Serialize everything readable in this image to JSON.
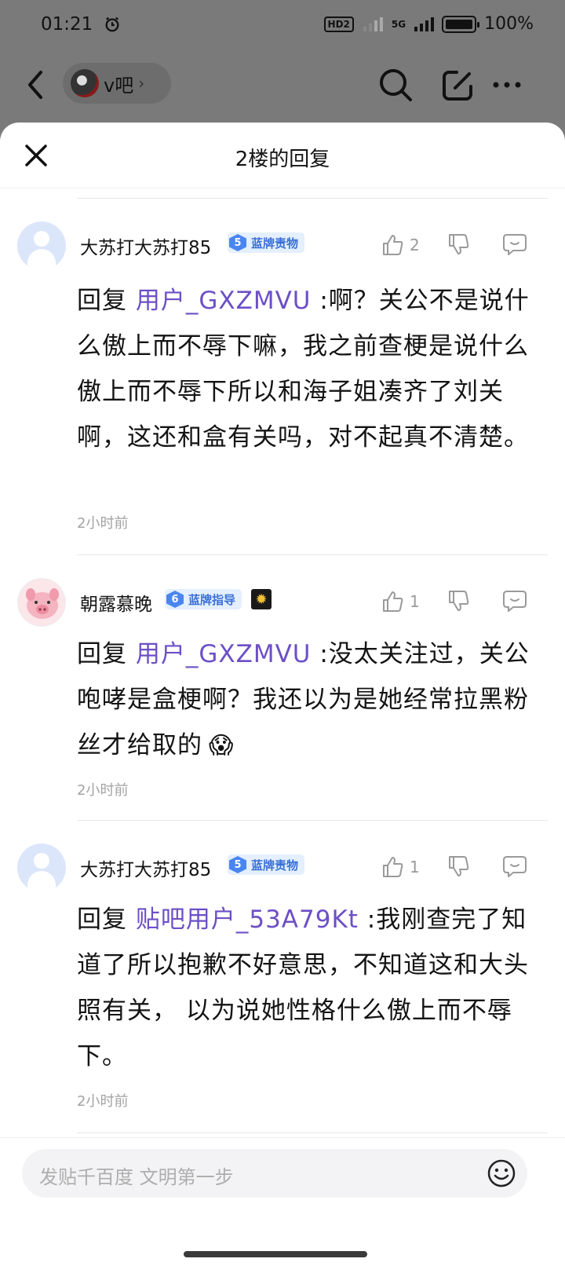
{
  "status_bar": {
    "time": "01:21",
    "hd_label": "HD2",
    "network_label": "5G",
    "battery": "100%"
  },
  "nav": {
    "forum_name": "v吧",
    "forum_chevron": "›"
  },
  "sheet": {
    "title": "2楼的回复"
  },
  "replies": [
    {
      "username": "大苏打大苏打85",
      "badge_level": "5",
      "badge_label": "蓝牌责物",
      "likes": "2",
      "reply_prefix": "回复 ",
      "mention": "用户_GXZMVU",
      "text": " :啊？关公不是说什么傲上而不辱下嘛，我之前查梗是说什么傲上而不辱下所以和海子姐凑齐了刘关啊，这还和盒有关吗，对不起真不清楚。",
      "time": "2小时前"
    },
    {
      "username": "朝露慕晚",
      "badge_level": "6",
      "badge_label": "蓝牌指导",
      "likes": "1",
      "reply_prefix": "回复 ",
      "mention": "用户_GXZMVU",
      "text": " :没太关注过，关公咆哮是盒梗啊？我还以为是她经常拉黑粉丝才给取的",
      "emoji": "😱",
      "time": "2小时前"
    },
    {
      "username": "大苏打大苏打85",
      "badge_level": "5",
      "badge_label": "蓝牌责物",
      "likes": "1",
      "reply_prefix": "回复 ",
      "mention": "贴吧用户_53A79Kt",
      "text": " :我刚查完了知道了所以抱歉不好意思，不知道这和大头照有关， 以为说她性格什么傲上而不辱下。",
      "time": "2小时前"
    }
  ],
  "composer": {
    "placeholder": "发贴千百度 文明第一步"
  },
  "icons": {
    "back": "back-arrow-icon",
    "search": "search-icon",
    "edit": "edit-icon",
    "more": "more-icon",
    "close": "close-icon",
    "like": "thumb-up-icon",
    "dislike": "thumb-down-icon",
    "comment": "comment-icon",
    "emoji": "emoji-icon"
  }
}
